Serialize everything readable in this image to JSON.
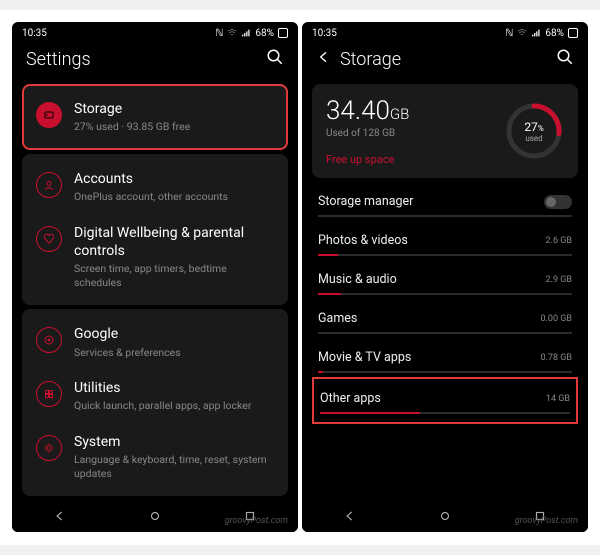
{
  "status": {
    "time": "10:35",
    "battery": "68%"
  },
  "left": {
    "title": "Settings",
    "items": [
      {
        "label": "Storage",
        "sub": "27% used · 93.85 GB free"
      },
      {
        "label": "Accounts",
        "sub": "OnePlus account, other accounts"
      },
      {
        "label": "Digital Wellbeing & parental controls",
        "sub": "Screen time, app timers, bedtime schedules"
      },
      {
        "label": "Google",
        "sub": "Services & preferences"
      },
      {
        "label": "Utilities",
        "sub": "Quick launch, parallel apps, app locker"
      },
      {
        "label": "System",
        "sub": "Language & keyboard, time, reset, system updates"
      }
    ]
  },
  "right": {
    "title": "Storage",
    "used_value": "34.40",
    "used_unit": "GB",
    "used_of": "Used of 128 GB",
    "pct": "27",
    "pct_unit": "%",
    "pct_label": "used",
    "freeup": "Free up space",
    "manager": "Storage manager",
    "rows": [
      {
        "label": "Photos & videos",
        "val": "2.6 GB",
        "fill": 8
      },
      {
        "label": "Music & audio",
        "val": "2.9 GB",
        "fill": 9
      },
      {
        "label": "Games",
        "val": "0.00 GB",
        "fill": 0
      },
      {
        "label": "Movie & TV apps",
        "val": "0.78 GB",
        "fill": 2
      },
      {
        "label": "Other apps",
        "val": "14 GB",
        "fill": 40
      }
    ]
  },
  "watermark": "groovyPost.com"
}
